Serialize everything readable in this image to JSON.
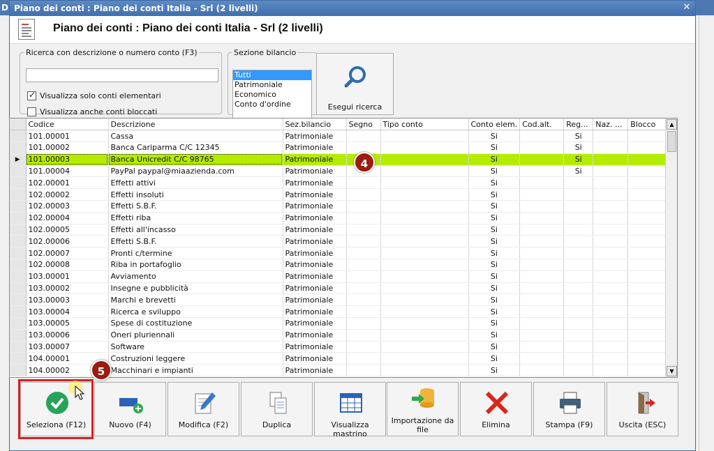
{
  "background_window": {
    "title_fragment": "DI"
  },
  "window": {
    "title": "Piano dei conti : Piano dei conti Italia - Srl (2 livelli)",
    "close_label": "✕"
  },
  "header": {
    "title": "Piano dei conti : Piano dei conti Italia - Srl (2 livelli)"
  },
  "search": {
    "legend": "Ricerca con descrizione o numero conto (F3)",
    "value": "",
    "only_elementary_label": "Visualizza solo conti elementari",
    "only_elementary_checked": true,
    "show_blocked_label": "Visualizza anche conti bloccati",
    "show_blocked_checked": false
  },
  "sezione": {
    "legend": "Sezione bilancio",
    "options": [
      "Tutti",
      "Patrimoniale",
      "Economico",
      "Conto d'ordine"
    ],
    "selected": "Tutti"
  },
  "search_button": {
    "label": "Esegui ricerca"
  },
  "grid": {
    "columns": [
      "Codice",
      "Descrizione",
      "Sez.bilancio",
      "Segno",
      "Tipo conto",
      "Conto elem.",
      "Cod.alt.",
      "Reg...",
      "Naz. ...",
      "Blocco"
    ],
    "selected_row": 2,
    "rows": [
      [
        "101.00001",
        "Cassa",
        "Patrimoniale",
        "",
        "",
        "Si",
        "",
        "Si",
        "",
        ""
      ],
      [
        "101.00002",
        "Banca Cariparma C/C 12345",
        "Patrimoniale",
        "",
        "",
        "Si",
        "",
        "Si",
        "",
        ""
      ],
      [
        "101.00003",
        "Banca Unicredit C/C 98765",
        "Patrimoniale",
        "",
        "",
        "Si",
        "",
        "Si",
        "",
        ""
      ],
      [
        "101.00004",
        "PayPal paypal@miaazienda.com",
        "Patrimoniale",
        "",
        "",
        "Si",
        "",
        "Si",
        "",
        ""
      ],
      [
        "102.00001",
        "Effetti attivi",
        "Patrimoniale",
        "",
        "",
        "Si",
        "",
        "",
        "",
        ""
      ],
      [
        "102.00002",
        "Effetti insoluti",
        "Patrimoniale",
        "",
        "",
        "Si",
        "",
        "",
        "",
        ""
      ],
      [
        "102.00003",
        "Effetti S.B.F.",
        "Patrimoniale",
        "",
        "",
        "Si",
        "",
        "",
        "",
        ""
      ],
      [
        "102.00004",
        "Effetti riba",
        "Patrimoniale",
        "",
        "",
        "Si",
        "",
        "",
        "",
        ""
      ],
      [
        "102.00005",
        "Effetti all'incasso",
        "Patrimoniale",
        "",
        "",
        "Si",
        "",
        "",
        "",
        ""
      ],
      [
        "102.00006",
        "Effetti S.B.F.",
        "Patrimoniale",
        "",
        "",
        "Si",
        "",
        "",
        "",
        ""
      ],
      [
        "102.00007",
        "Pronti c/termine",
        "Patrimoniale",
        "",
        "",
        "Si",
        "",
        "",
        "",
        ""
      ],
      [
        "102.00008",
        "Riba in portafoglio",
        "Patrimoniale",
        "",
        "",
        "Si",
        "",
        "",
        "",
        ""
      ],
      [
        "103.00001",
        "Avviamento",
        "Patrimoniale",
        "",
        "",
        "Si",
        "",
        "",
        "",
        ""
      ],
      [
        "103.00002",
        "Insegne e pubblicità",
        "Patrimoniale",
        "",
        "",
        "Si",
        "",
        "",
        "",
        ""
      ],
      [
        "103.00003",
        "Marchi e brevetti",
        "Patrimoniale",
        "",
        "",
        "Si",
        "",
        "",
        "",
        ""
      ],
      [
        "103.00004",
        "Ricerca e sviluppo",
        "Patrimoniale",
        "",
        "",
        "Si",
        "",
        "",
        "",
        ""
      ],
      [
        "103.00005",
        "Spese di costituzione",
        "Patrimoniale",
        "",
        "",
        "Si",
        "",
        "",
        "",
        ""
      ],
      [
        "103.00006",
        "Oneri pluriennali",
        "Patrimoniale",
        "",
        "",
        "Si",
        "",
        "",
        "",
        ""
      ],
      [
        "103.00007",
        "Software",
        "Patrimoniale",
        "",
        "",
        "Si",
        "",
        "",
        "",
        ""
      ],
      [
        "104.00001",
        "Costruzioni leggere",
        "Patrimoniale",
        "",
        "",
        "Si",
        "",
        "",
        "",
        ""
      ],
      [
        "104.00002",
        "Macchinari e impianti",
        "Patrimoniale",
        "",
        "",
        "Si",
        "",
        "",
        "",
        ""
      ]
    ]
  },
  "badges": {
    "step4": "4",
    "step5": "5"
  },
  "toolbar": [
    {
      "name": "select-button",
      "icon": "check-circle-icon",
      "label": "Seleziona (F12)"
    },
    {
      "name": "new-button",
      "icon": "new-record-icon",
      "label": "Nuovo (F4)"
    },
    {
      "name": "edit-button",
      "icon": "edit-pencil-icon",
      "label": "Modifica (F2)"
    },
    {
      "name": "duplicate-button",
      "icon": "copy-documents-icon",
      "label": "Duplica"
    },
    {
      "name": "ledger-button",
      "icon": "table-grid-icon",
      "label": "Visualizza mastrino"
    },
    {
      "name": "import-button",
      "icon": "database-import-icon",
      "label": "Importazione da file"
    },
    {
      "name": "delete-button",
      "icon": "red-x-icon",
      "label": "Elimina"
    },
    {
      "name": "print-button",
      "icon": "printer-icon",
      "label": "Stampa (F9)"
    },
    {
      "name": "exit-button",
      "icon": "exit-door-icon",
      "label": "Uscita (ESC)"
    }
  ],
  "colors": {
    "selected_row": "#b4ec00",
    "badge": "#9a1d10",
    "highlight_frame": "#d62020",
    "titlebar": "#4d79b0"
  }
}
